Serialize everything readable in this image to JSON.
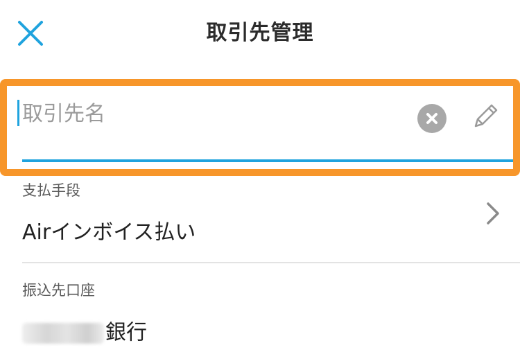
{
  "header": {
    "title": "取引先管理",
    "close_icon": "close-icon"
  },
  "name_field": {
    "placeholder": "取引先名",
    "value": "",
    "clear_icon": "clear-circle-icon",
    "edit_icon": "pencil-icon"
  },
  "payment": {
    "label": "支払手段",
    "value": "Airインボイス払い",
    "chevron_icon": "chevron-right-icon"
  },
  "bank_account": {
    "label": "振込先口座",
    "bank_suffix": "銀行"
  },
  "colors": {
    "accent": "#1fa3de",
    "highlight": "#f7962a",
    "clear_button": "#a8a8a8"
  }
}
